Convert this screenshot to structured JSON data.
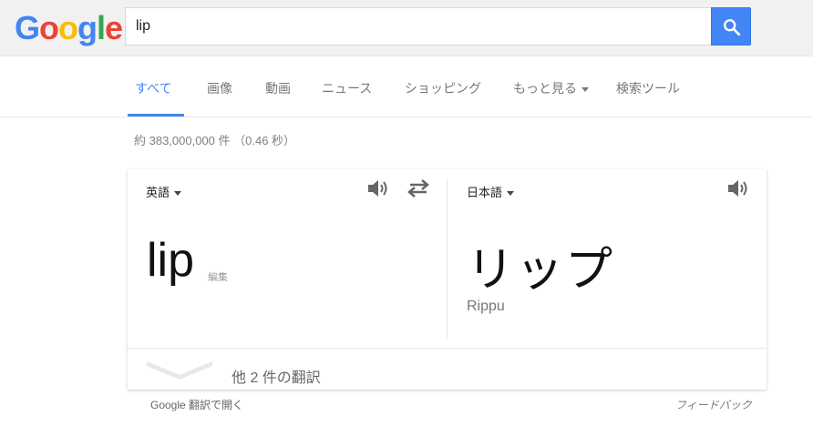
{
  "header": {
    "logo_letters": [
      {
        "char": "G",
        "color": "#4285f4"
      },
      {
        "char": "o",
        "color": "#ea4335"
      },
      {
        "char": "o",
        "color": "#fbbc05"
      },
      {
        "char": "g",
        "color": "#4285f4"
      },
      {
        "char": "l",
        "color": "#34a853"
      },
      {
        "char": "e",
        "color": "#ea4335"
      }
    ],
    "search_value": "lip",
    "search_icon": "magnifier-icon"
  },
  "tabs": {
    "items": [
      {
        "label": "すべて",
        "active": true
      },
      {
        "label": "画像"
      },
      {
        "label": "動画"
      },
      {
        "label": "ニュース"
      },
      {
        "label": "ショッピング"
      },
      {
        "label": "もっと見る",
        "dropdown": true
      },
      {
        "label": "検索ツール"
      }
    ]
  },
  "results": {
    "stats": "約 383,000,000 件 （0.46 秒）"
  },
  "translate": {
    "source_lang": "英語",
    "target_lang": "日本語",
    "source_word": "lip",
    "edit_label": "編集",
    "target_word": "リップ",
    "target_romanization": "Rippu",
    "more_translations": "他 2 件の翻訳",
    "icons": {
      "source_speaker": "speaker-icon",
      "swap": "swap-icon",
      "target_speaker": "speaker-icon",
      "expand": "chevron-down-icon"
    }
  },
  "footer": {
    "open_in_translate": "Google 翻訳で開く",
    "feedback": "フィードバック"
  },
  "colors": {
    "accent": "#4285f4",
    "header_bg": "#f1f1f1"
  }
}
